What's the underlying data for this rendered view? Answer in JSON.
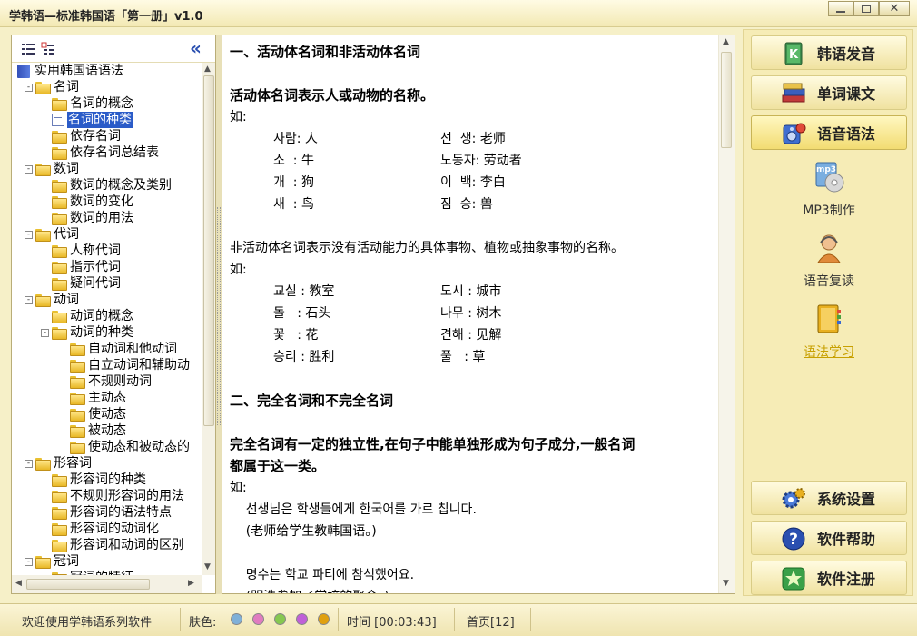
{
  "window": {
    "title": "学韩语—标准韩国语「第一册」v1.0"
  },
  "tree": [
    {
      "label": "实用韩国语语法",
      "level": 0,
      "icon": "book",
      "expander": ""
    },
    {
      "label": "名词",
      "level": 1,
      "icon": "folder",
      "expander": "-"
    },
    {
      "label": "名词的概念",
      "level": 2,
      "icon": "folder"
    },
    {
      "label": "名词的种类",
      "level": 2,
      "icon": "doc",
      "selected": true
    },
    {
      "label": "依存名词",
      "level": 2,
      "icon": "folder"
    },
    {
      "label": "依存名词总结表",
      "level": 2,
      "icon": "folder"
    },
    {
      "label": "数词",
      "level": 1,
      "icon": "folder",
      "expander": "-"
    },
    {
      "label": "数词的概念及类别",
      "level": 2,
      "icon": "folder"
    },
    {
      "label": "数词的变化",
      "level": 2,
      "icon": "folder"
    },
    {
      "label": "数词的用法",
      "level": 2,
      "icon": "folder"
    },
    {
      "label": "代词",
      "level": 1,
      "icon": "folder",
      "expander": "-"
    },
    {
      "label": "人称代词",
      "level": 2,
      "icon": "folder"
    },
    {
      "label": "指示代词",
      "level": 2,
      "icon": "folder"
    },
    {
      "label": "疑问代词",
      "level": 2,
      "icon": "folder"
    },
    {
      "label": "动词",
      "level": 1,
      "icon": "folder",
      "expander": "-"
    },
    {
      "label": "动词的概念",
      "level": 2,
      "icon": "folder"
    },
    {
      "label": "动词的种类",
      "level": 2,
      "icon": "folder",
      "expander": "-"
    },
    {
      "label": "自动词和他动词",
      "level": 3,
      "icon": "folder"
    },
    {
      "label": "自立动词和辅助动",
      "level": 3,
      "icon": "folder"
    },
    {
      "label": "不规则动词",
      "level": 3,
      "icon": "folder"
    },
    {
      "label": "主动态",
      "level": 3,
      "icon": "folder"
    },
    {
      "label": "使动态",
      "level": 3,
      "icon": "folder"
    },
    {
      "label": "被动态",
      "level": 3,
      "icon": "folder"
    },
    {
      "label": "使动态和被动态的",
      "level": 3,
      "icon": "folder"
    },
    {
      "label": "形容词",
      "level": 1,
      "icon": "folder",
      "expander": "-"
    },
    {
      "label": "形容词的种类",
      "level": 2,
      "icon": "folder"
    },
    {
      "label": "不规则形容词的用法",
      "level": 2,
      "icon": "folder"
    },
    {
      "label": "形容词的语法特点",
      "level": 2,
      "icon": "folder"
    },
    {
      "label": "形容词的动词化",
      "level": 2,
      "icon": "folder"
    },
    {
      "label": "形容词和动词的区别",
      "level": 2,
      "icon": "folder"
    },
    {
      "label": "冠词",
      "level": 1,
      "icon": "folder",
      "expander": "-"
    },
    {
      "label": "冠词的特征",
      "level": 2,
      "icon": "folder"
    }
  ],
  "content": {
    "lines": [
      {
        "text": "一、活动体名词和非活动体名词",
        "bold": true
      },
      {
        "text": "",
        "bold": false
      },
      {
        "text": "活动体名词表示人或动物的名称。",
        "bold": true
      },
      {
        "text": "如:",
        "bold": false
      },
      {
        "text": "",
        "bold": false
      },
      {
        "text": "",
        "bold": false
      },
      {
        "text": "",
        "bold": false
      },
      {
        "text": "",
        "bold": false
      },
      {
        "text": "",
        "bold": false
      },
      {
        "text": "非活动体名词表示没有活动能力的具体事物、植物或抽象事物的名称。",
        "bold": false
      },
      {
        "text": "如:",
        "bold": false
      },
      {
        "text": "",
        "bold": false
      },
      {
        "text": "",
        "bold": false
      },
      {
        "text": "",
        "bold": false
      },
      {
        "text": "",
        "bold": false
      },
      {
        "text": "",
        "bold": false
      },
      {
        "text": "二、完全名词和不完全名词",
        "bold": true
      },
      {
        "text": "",
        "bold": false
      },
      {
        "text": "完全名词有一定的独立性,在句子中能单独形成为句子成分,一般名词",
        "bold": true
      },
      {
        "text": "都属于这一类。",
        "bold": true
      },
      {
        "text": "如:",
        "bold": false
      },
      {
        "text": "    선생님은 학생들에게 한국어를 가르 칩니다.",
        "bold": false
      },
      {
        "text": "    (老师给学生教韩国语。)",
        "bold": false
      },
      {
        "text": "",
        "bold": false
      },
      {
        "text": "    명수는 학교 파티에 참석했어요.",
        "bold": false
      },
      {
        "text": "    (明洙参加了学校的聚会。)",
        "bold": false
      }
    ],
    "animate_examples": [
      [
        "사람: 人",
        "선  생: 老师"
      ],
      [
        "소  : 牛",
        "노동자: 劳动者"
      ],
      [
        "개  : 狗",
        "이  백: 李白"
      ],
      [
        "새  : 鸟",
        "짐  승: 兽"
      ]
    ],
    "inanimate_examples": [
      [
        "교실 : 教室",
        "도시 : 城市"
      ],
      [
        "돌   : 石头",
        "나무 : 树木"
      ],
      [
        "꽃   : 花",
        "견해 : 见解"
      ],
      [
        "승리 : 胜利",
        "풀   : 草"
      ]
    ]
  },
  "right_buttons_top": [
    "韩语发音",
    "单词课文",
    "语音语法"
  ],
  "features": [
    "MP3制作",
    "语音复读",
    "语法学习"
  ],
  "right_buttons_bottom": [
    "系统设置",
    "软件帮助",
    "软件注册"
  ],
  "status": {
    "welcome": "欢迎使用学韩语系列软件",
    "skin_label": "肤色:",
    "skin_colors": [
      "#7fb0d8",
      "#e07cc0",
      "#86c850",
      "#c060d8",
      "#e0a010"
    ],
    "time": "时间 [00:03:43]",
    "page": "首页[12]"
  },
  "colors": {
    "selected": "#2a5bc8",
    "accent": "#f2dc72",
    "feature_link": "#c8a000"
  }
}
